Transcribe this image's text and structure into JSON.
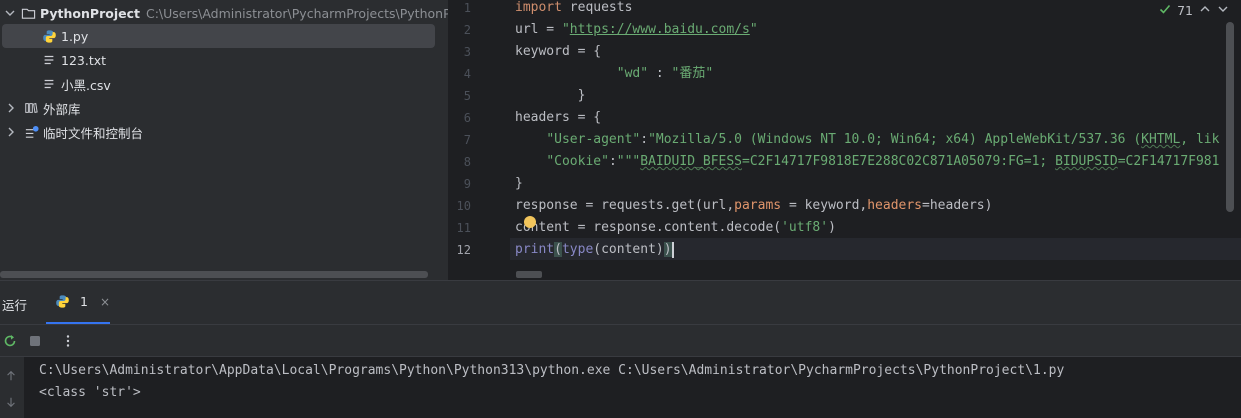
{
  "project_tree": {
    "root": {
      "name": "PythonProject",
      "path": "C:\\Users\\Administrator\\PycharmProjects\\PythonProject"
    },
    "files": [
      "1.py",
      "123.txt",
      "小黑.csv"
    ],
    "external_libs": "外部库",
    "scratches": "临时文件和控制台"
  },
  "editor": {
    "inspection_count": "71",
    "line_numbers": [
      "1",
      "2",
      "3",
      "4",
      "5",
      "6",
      "7",
      "8",
      "9",
      "10",
      "11",
      "12"
    ],
    "code": {
      "l1_kw": "import",
      "l1_rest": " requests",
      "l2_a": "url = ",
      "l2_q1": "\"",
      "l2_url": "https://www.baidu.com/s",
      "l2_q2": "\"",
      "l3": "keyword = {",
      "l4_ind": "             ",
      "l4_key": "\"wd\"",
      "l4_mid": " : ",
      "l4_val": "\"番茄\"",
      "l5": "        }",
      "l6": "headers = {",
      "l7_ind": "    ",
      "l7_key": "\"User-agent\"",
      "l7_colon": ":",
      "l7_val": "\"Mozilla/5.0 (Windows NT 10.0; Win64; x64) AppleWebKit/537.36 (",
      "l7_khtml": "KHTML",
      "l7_tail": ", lik",
      "l8_ind": "    ",
      "l8_key": "\"Cookie\"",
      "l8_colon": ":",
      "l8_open": "\"\"\"",
      "l8_a": "BAIDUID_BFESS",
      "l8_b": "=C2F14717F9818E7E288C02C871A05079:FG=1; ",
      "l8_c": "BIDUPSID",
      "l8_d": "=C2F14717F981",
      "l9": "}",
      "l10_a": "response = requests.get(url,",
      "l10_p1": "params",
      "l10_b": " = keyword,",
      "l10_p2": "headers",
      "l10_c": "=headers)",
      "l11_a": "content = response.content.decode(",
      "l11_s": "'utf8'",
      "l11_b": ")",
      "l12_print": "print",
      "l12_open": "(",
      "l12_type": "type",
      "l12_mid": "(content)",
      "l12_close": ")"
    }
  },
  "run_panel": {
    "title": "运行",
    "tab_label": "1",
    "tab_close": "×",
    "output": [
      "C:\\Users\\Administrator\\AppData\\Local\\Programs\\Python\\Python313\\python.exe C:\\Users\\Administrator\\PycharmProjects\\PythonProject\\1.py",
      "<class 'str'>"
    ]
  },
  "colors": {
    "accent": "#3574f0",
    "keyword": "#cf8e6d",
    "string": "#6aab73",
    "builtin": "#8888c6"
  }
}
